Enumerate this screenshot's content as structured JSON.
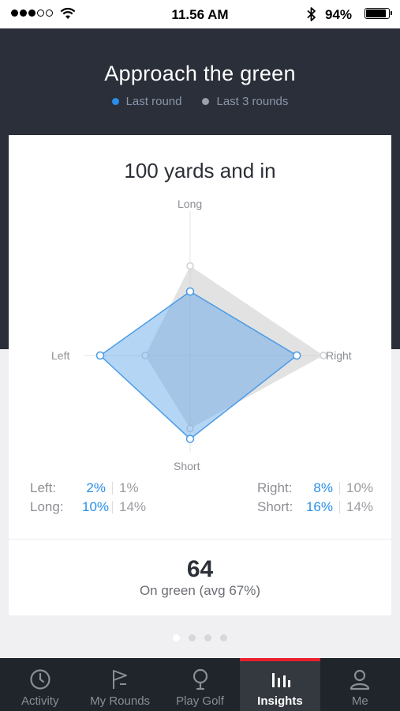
{
  "status_bar": {
    "signal_dots_filled": 3,
    "signal_dots_total": 5,
    "time": "11.56 AM",
    "battery_percent": "94%",
    "battery_level": 0.94,
    "icons": [
      "wifi-icon",
      "bluetooth-icon",
      "battery-icon"
    ]
  },
  "header": {
    "title": "Approach the green",
    "legend": [
      {
        "label": "Last round",
        "color": "#2a8ee8"
      },
      {
        "label": "Last 3 rounds",
        "color": "#9aa1ad"
      }
    ]
  },
  "card": {
    "title": "100 yards and in",
    "axis_labels": {
      "top": "Long",
      "bottom": "Short",
      "left": "Left",
      "right": "Right"
    },
    "stats": {
      "left_col": [
        {
          "label": "Left:",
          "last": "2%",
          "avg": "1%"
        },
        {
          "label": "Long:",
          "last": "10%",
          "avg": "14%"
        }
      ],
      "right_col": [
        {
          "label": "Right:",
          "last": "8%",
          "avg": "10%"
        },
        {
          "label": "Short:",
          "last": "16%",
          "avg": "14%"
        }
      ]
    },
    "on_green_count": "64",
    "on_green_caption": "On green (avg 67%)"
  },
  "chart_data": {
    "type": "radar",
    "axes": [
      "Long",
      "Right",
      "Short",
      "Left"
    ],
    "series": [
      {
        "name": "Last round",
        "values": [
          10,
          8,
          16,
          2
        ],
        "color": "#2a8ee8"
      },
      {
        "name": "Last 3 rounds",
        "values": [
          14,
          10,
          14,
          1
        ],
        "color": "#c8c9cc"
      }
    ]
  },
  "pager": {
    "count": 4,
    "active": 0
  },
  "tabs": [
    {
      "label": "Activity",
      "icon": "clock-icon",
      "active": false
    },
    {
      "label": "My Rounds",
      "icon": "flag-icon",
      "active": false
    },
    {
      "label": "Play Golf",
      "icon": "golf-ball-icon",
      "active": false
    },
    {
      "label": "Insights",
      "icon": "bar-chart-icon",
      "active": true
    },
    {
      "label": "Me",
      "icon": "person-icon",
      "active": false
    }
  ]
}
